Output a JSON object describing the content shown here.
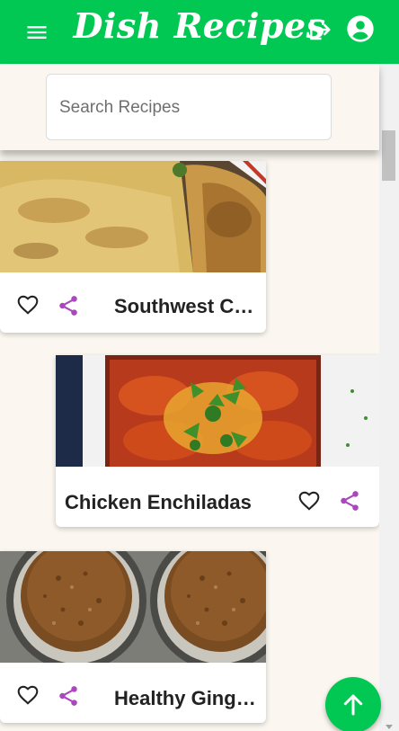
{
  "app": {
    "title": "Dish Recipes"
  },
  "search": {
    "placeholder": "Search Recipes",
    "value": ""
  },
  "recipes": [
    {
      "name": "Southwest Chicken…"
    },
    {
      "name": "Chicken Enchiladas"
    },
    {
      "name": "Healthy Gingerbrea…"
    }
  ],
  "icons": {
    "menu": "hamburger-menu-icon",
    "logout": "logout-icon",
    "account": "account-circle-icon",
    "favorite": "heart-outline-icon",
    "share": "share-icon",
    "scroll_top": "arrow-up-icon"
  },
  "colors": {
    "brand": "#00c853",
    "share_accent": "#ab47bc",
    "background": "#fbf7f0"
  }
}
